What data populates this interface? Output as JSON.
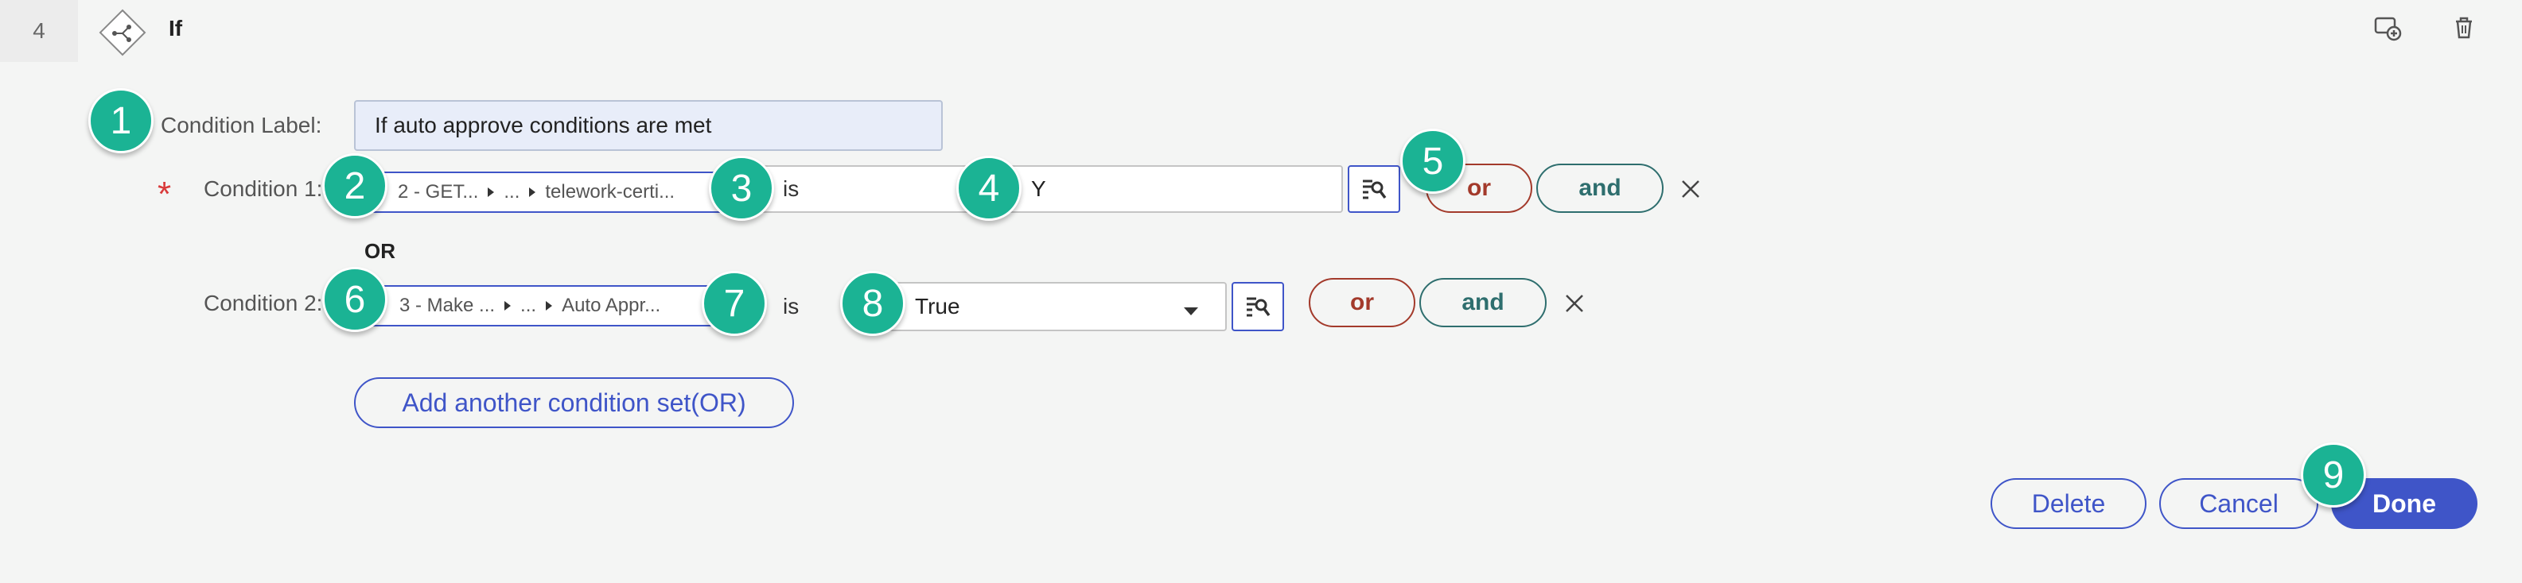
{
  "step": {
    "number": "4",
    "title": "If"
  },
  "toolbar": {
    "icons": [
      "comment-add-icon",
      "trash-icon"
    ]
  },
  "condition_label": {
    "label": "Condition Label:",
    "value": "If auto approve conditions are met"
  },
  "condition1": {
    "label": "Condition 1:",
    "path": [
      "2 - GET...",
      "...",
      "telework-certi..."
    ],
    "operator": "is",
    "value": "Y",
    "or_label": "or",
    "and_label": "and"
  },
  "or_separator": "OR",
  "condition2": {
    "label": "Condition 2:",
    "path": [
      "3 - Make ...",
      "...",
      "Auto Appr..."
    ],
    "operator": "is",
    "value": "True",
    "or_label": "or",
    "and_label": "and"
  },
  "add_condition_set": "Add another condition set(OR)",
  "footer": {
    "delete": "Delete",
    "cancel": "Cancel",
    "done": "Done"
  },
  "callouts": [
    "1",
    "2",
    "3",
    "4",
    "5",
    "6",
    "7",
    "8",
    "9"
  ],
  "colors": {
    "accent": "#3f55c8",
    "callout": "#1bb394",
    "or": "#a33a2b",
    "and": "#2e6e6e",
    "required": "#d93a3a"
  }
}
